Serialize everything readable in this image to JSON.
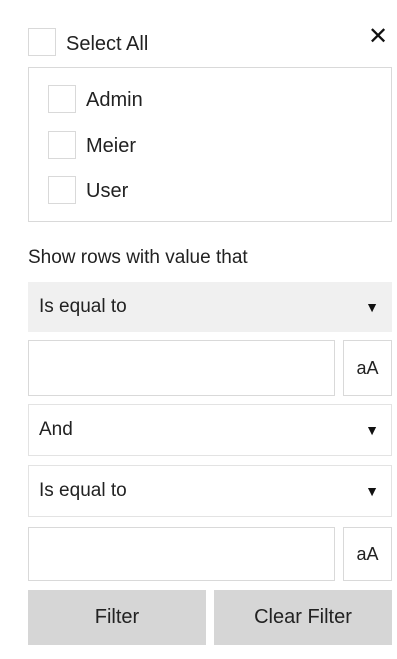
{
  "select_all": {
    "label": "Select All",
    "checked": false
  },
  "close_glyph": "✕",
  "values": [
    {
      "label": "Admin",
      "checked": false
    },
    {
      "label": "Meier",
      "checked": false
    },
    {
      "label": "User",
      "checked": false
    }
  ],
  "condition_caption": "Show rows with value that",
  "condition1": {
    "operator": "Is equal to",
    "value": "",
    "case_toggle": "aA"
  },
  "logic": {
    "operator": "And"
  },
  "condition2": {
    "operator": "Is equal to",
    "value": "",
    "case_toggle": "aA"
  },
  "dropdown_arrow": "▼",
  "buttons": {
    "filter": "Filter",
    "clear_filter": "Clear Filter"
  }
}
